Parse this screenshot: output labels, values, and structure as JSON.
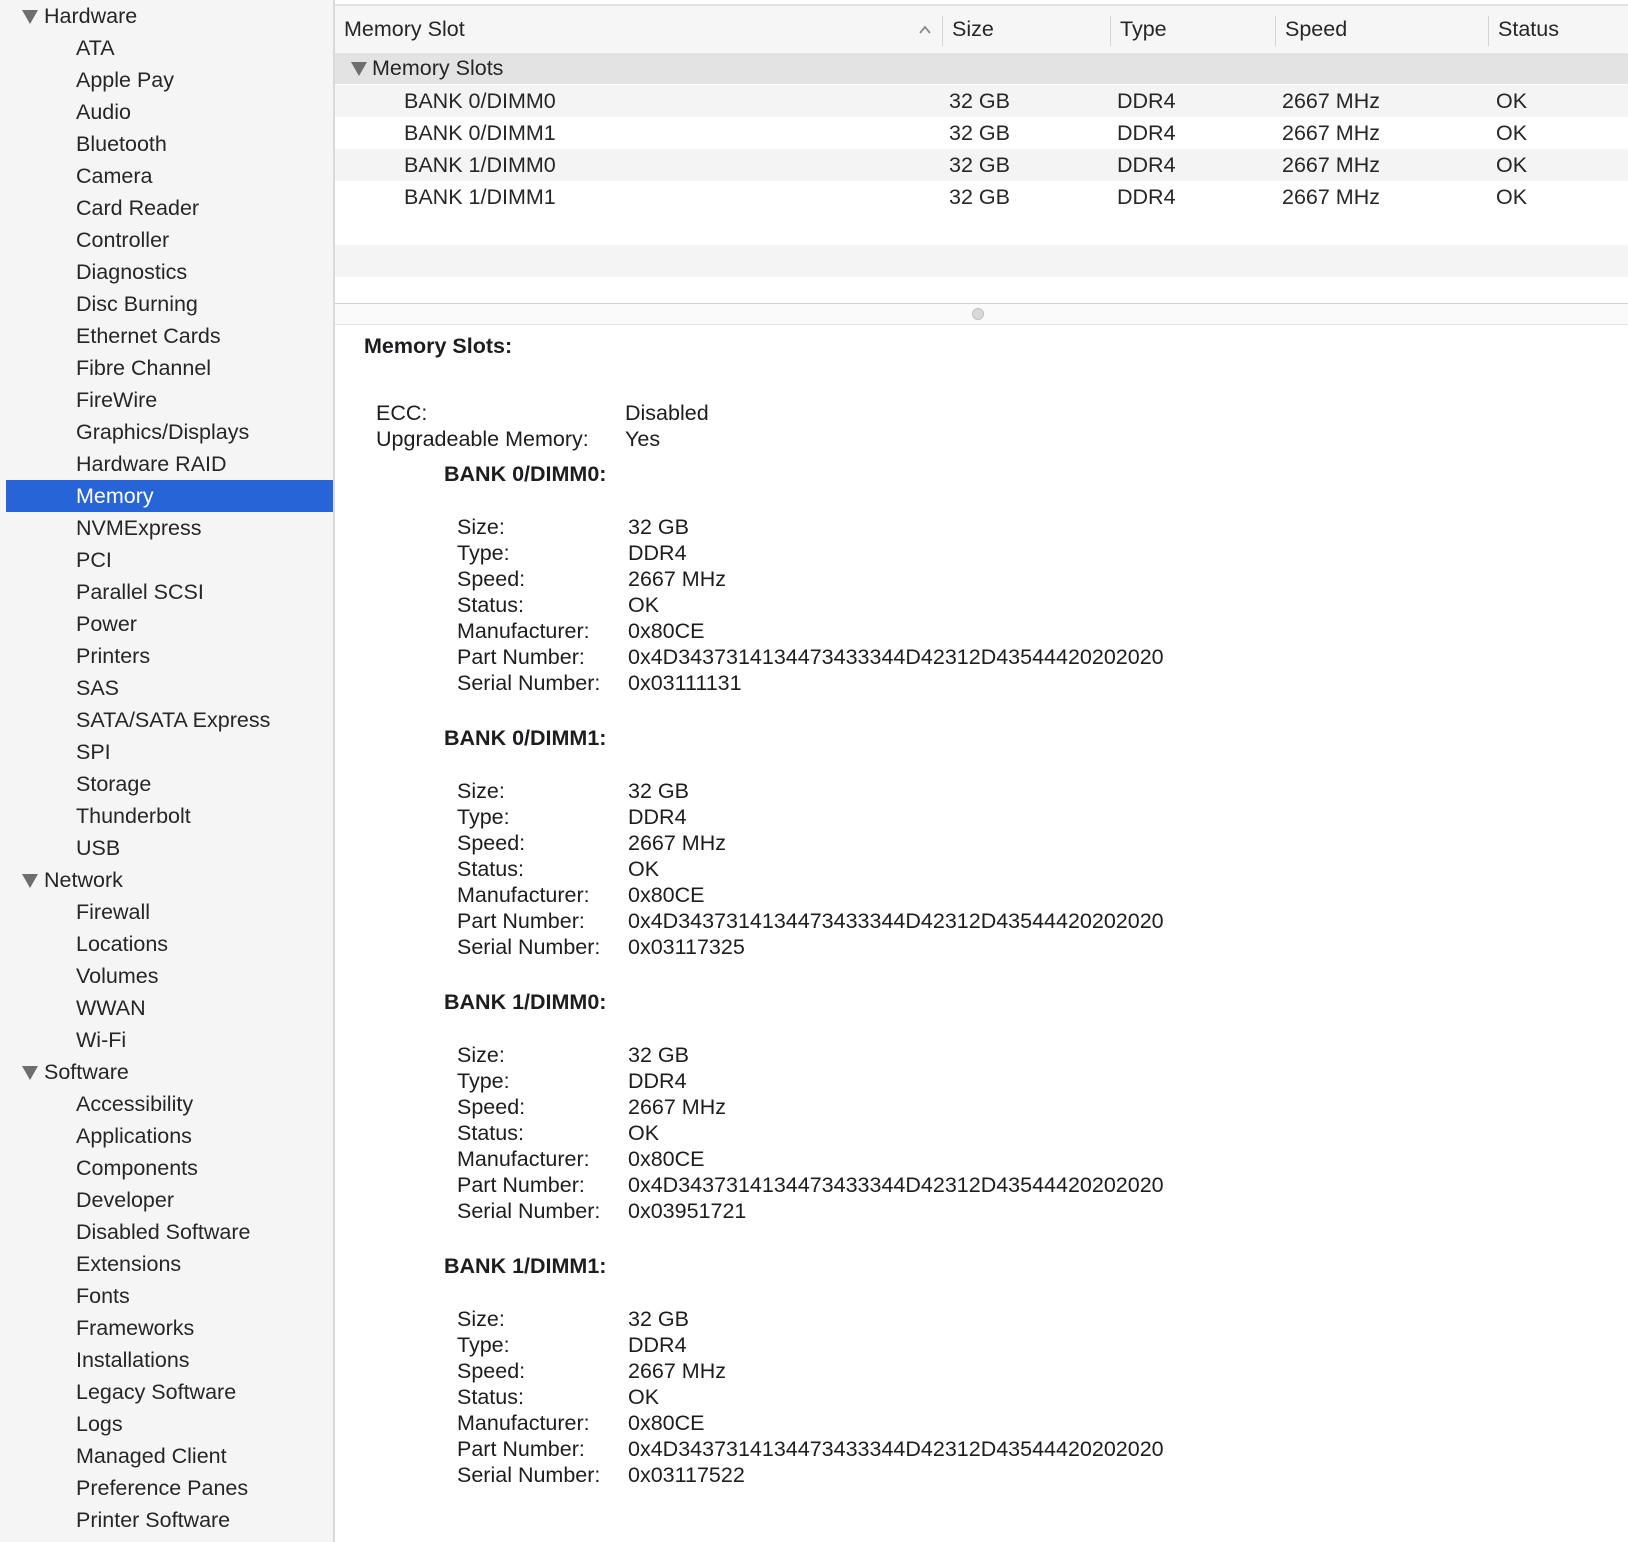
{
  "sidebar": {
    "groups": [
      {
        "label": "Hardware",
        "items": [
          "ATA",
          "Apple Pay",
          "Audio",
          "Bluetooth",
          "Camera",
          "Card Reader",
          "Controller",
          "Diagnostics",
          "Disc Burning",
          "Ethernet Cards",
          "Fibre Channel",
          "FireWire",
          "Graphics/Displays",
          "Hardware RAID",
          "Memory",
          "NVMExpress",
          "PCI",
          "Parallel SCSI",
          "Power",
          "Printers",
          "SAS",
          "SATA/SATA Express",
          "SPI",
          "Storage",
          "Thunderbolt",
          "USB"
        ]
      },
      {
        "label": "Network",
        "items": [
          "Firewall",
          "Locations",
          "Volumes",
          "WWAN",
          "Wi-Fi"
        ]
      },
      {
        "label": "Software",
        "items": [
          "Accessibility",
          "Applications",
          "Components",
          "Developer",
          "Disabled Software",
          "Extensions",
          "Fonts",
          "Frameworks",
          "Installations",
          "Legacy Software",
          "Logs",
          "Managed Client",
          "Preference Panes",
          "Printer Software"
        ]
      }
    ],
    "selected": "Memory"
  },
  "table": {
    "columns": [
      "Memory Slot",
      "Size",
      "Type",
      "Speed",
      "Status"
    ],
    "group_label": "Memory Slots",
    "rows": [
      {
        "slot": "BANK 0/DIMM0",
        "size": "32 GB",
        "type": "DDR4",
        "speed": "2667 MHz",
        "status": "OK"
      },
      {
        "slot": "BANK 0/DIMM1",
        "size": "32 GB",
        "type": "DDR4",
        "speed": "2667 MHz",
        "status": "OK"
      },
      {
        "slot": "BANK 1/DIMM0",
        "size": "32 GB",
        "type": "DDR4",
        "speed": "2667 MHz",
        "status": "OK"
      },
      {
        "slot": "BANK 1/DIMM1",
        "size": "32 GB",
        "type": "DDR4",
        "speed": "2667 MHz",
        "status": "OK"
      }
    ]
  },
  "detail": {
    "title": "Memory Slots:",
    "summary": [
      {
        "key": "ECC:",
        "value": "Disabled"
      },
      {
        "key": "Upgradeable Memory:",
        "value": "Yes"
      }
    ],
    "banks": [
      {
        "title": "BANK 0/DIMM0:",
        "fields": [
          {
            "key": "Size:",
            "value": "32 GB"
          },
          {
            "key": "Type:",
            "value": "DDR4"
          },
          {
            "key": "Speed:",
            "value": "2667 MHz"
          },
          {
            "key": "Status:",
            "value": "OK"
          },
          {
            "key": "Manufacturer:",
            "value": "0x80CE"
          },
          {
            "key": "Part Number:",
            "value": "0x4D3437314134473433344D42312D43544420202020"
          },
          {
            "key": "Serial Number:",
            "value": "0x03111131"
          }
        ]
      },
      {
        "title": "BANK 0/DIMM1:",
        "fields": [
          {
            "key": "Size:",
            "value": "32 GB"
          },
          {
            "key": "Type:",
            "value": "DDR4"
          },
          {
            "key": "Speed:",
            "value": "2667 MHz"
          },
          {
            "key": "Status:",
            "value": "OK"
          },
          {
            "key": "Manufacturer:",
            "value": "0x80CE"
          },
          {
            "key": "Part Number:",
            "value": "0x4D3437314134473433344D42312D43544420202020"
          },
          {
            "key": "Serial Number:",
            "value": "0x03117325"
          }
        ]
      },
      {
        "title": "BANK 1/DIMM0:",
        "fields": [
          {
            "key": "Size:",
            "value": "32 GB"
          },
          {
            "key": "Type:",
            "value": "DDR4"
          },
          {
            "key": "Speed:",
            "value": "2667 MHz"
          },
          {
            "key": "Status:",
            "value": "OK"
          },
          {
            "key": "Manufacturer:",
            "value": "0x80CE"
          },
          {
            "key": "Part Number:",
            "value": "0x4D3437314134473433344D42312D43544420202020"
          },
          {
            "key": "Serial Number:",
            "value": "0x03951721"
          }
        ]
      },
      {
        "title": "BANK 1/DIMM1:",
        "fields": [
          {
            "key": "Size:",
            "value": "32 GB"
          },
          {
            "key": "Type:",
            "value": "DDR4"
          },
          {
            "key": "Speed:",
            "value": "2667 MHz"
          },
          {
            "key": "Status:",
            "value": "OK"
          },
          {
            "key": "Manufacturer:",
            "value": "0x80CE"
          },
          {
            "key": "Part Number:",
            "value": "0x4D3437314134473433344D42312D43544420202020"
          },
          {
            "key": "Serial Number:",
            "value": "0x03117522"
          }
        ]
      }
    ]
  },
  "colors": {
    "selection": "#2764d6",
    "sidebar_bg": "#f5f5f5",
    "group_row_bg": "#e3e3e3"
  },
  "icons": {
    "disclosure": "disclosure-triangle-icon",
    "sort": "sort-ascending-icon",
    "split": "split-handle-icon"
  }
}
